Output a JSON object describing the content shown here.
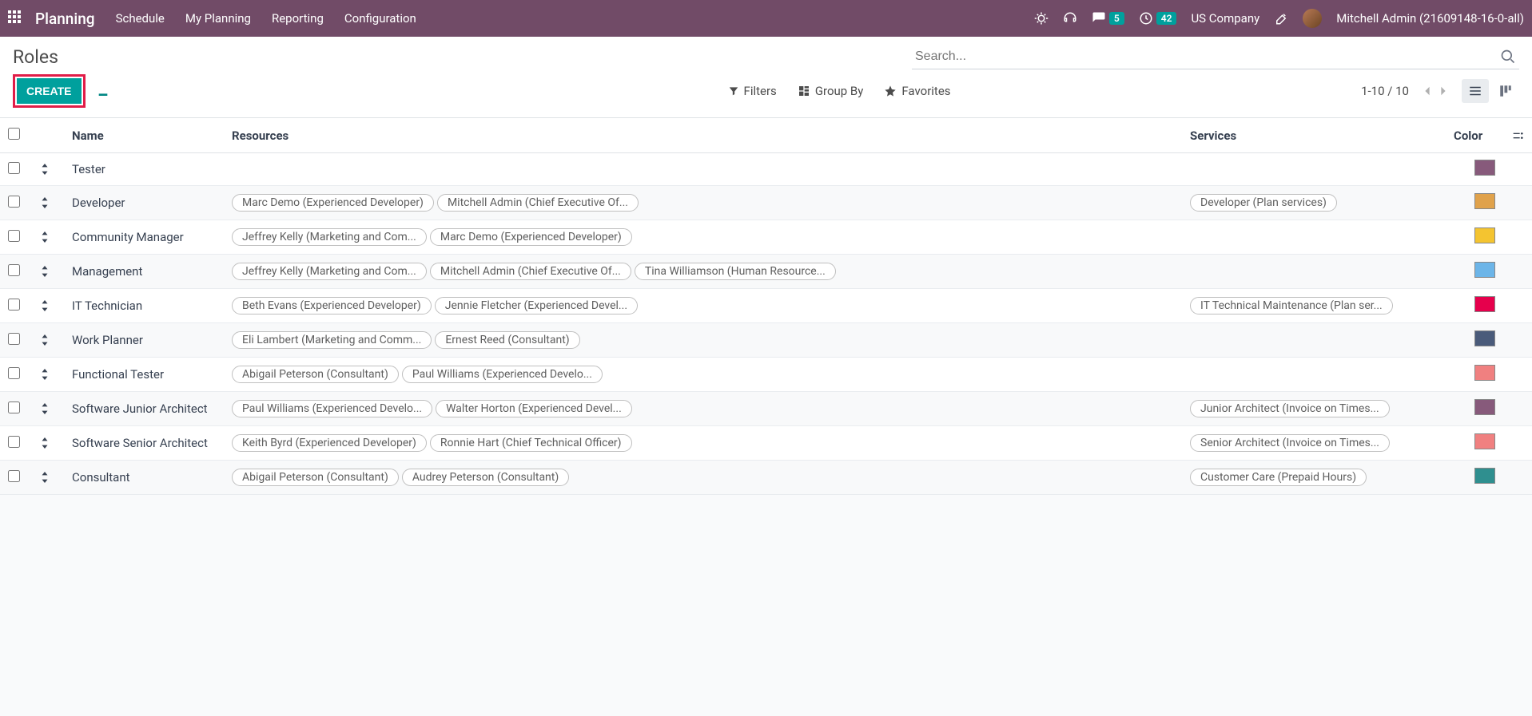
{
  "topbar": {
    "brand": "Planning",
    "menu": [
      "Schedule",
      "My Planning",
      "Reporting",
      "Configuration"
    ],
    "messages_badge": "5",
    "activities_badge": "42",
    "company": "US Company",
    "user": "Mitchell Admin (21609148-16-0-all)"
  },
  "control_panel": {
    "title": "Roles",
    "create_label": "Create",
    "search_placeholder": "Search...",
    "filters_label": "Filters",
    "groupby_label": "Group By",
    "favorites_label": "Favorites",
    "pager": "1-10 / 10"
  },
  "columns": {
    "name": "Name",
    "resources": "Resources",
    "services": "Services",
    "color": "Color"
  },
  "rows": [
    {
      "name": "Tester",
      "resources": [],
      "services": [],
      "color": "#875A7B"
    },
    {
      "name": "Developer",
      "resources": [
        "Marc Demo (Experienced Developer)",
        "Mitchell Admin (Chief Executive Of..."
      ],
      "services": [
        "Developer (Plan services)"
      ],
      "color": "#E0A24B"
    },
    {
      "name": "Community Manager",
      "resources": [
        "Jeffrey Kelly (Marketing and Com...",
        "Marc Demo (Experienced Developer)"
      ],
      "services": [],
      "color": "#F4C430"
    },
    {
      "name": "Management",
      "resources": [
        "Jeffrey Kelly (Marketing and Com...",
        "Mitchell Admin (Chief Executive Of...",
        "Tina Williamson (Human Resource..."
      ],
      "services": [],
      "color": "#6CB5E8"
    },
    {
      "name": "IT Technician",
      "resources": [
        "Beth Evans (Experienced Developer)",
        "Jennie Fletcher (Experienced Devel..."
      ],
      "services": [
        "IT Technical Maintenance (Plan ser..."
      ],
      "color": "#E6004C"
    },
    {
      "name": "Work Planner",
      "resources": [
        "Eli Lambert (Marketing and Comm...",
        "Ernest Reed (Consultant)"
      ],
      "services": [],
      "color": "#4A5B7A"
    },
    {
      "name": "Functional Tester",
      "resources": [
        "Abigail Peterson (Consultant)",
        "Paul Williams (Experienced Develo..."
      ],
      "services": [],
      "color": "#F08080"
    },
    {
      "name": "Software Junior Architect",
      "resources": [
        "Paul Williams (Experienced Develo...",
        "Walter Horton (Experienced Devel..."
      ],
      "services": [
        "Junior Architect (Invoice on Times..."
      ],
      "color": "#875A7B"
    },
    {
      "name": "Software Senior Architect",
      "resources": [
        "Keith Byrd (Experienced Developer)",
        "Ronnie Hart (Chief Technical Officer)"
      ],
      "services": [
        "Senior Architect (Invoice on Times..."
      ],
      "color": "#F08080"
    },
    {
      "name": "Consultant",
      "resources": [
        "Abigail Peterson (Consultant)",
        "Audrey Peterson (Consultant)"
      ],
      "services": [
        "Customer Care (Prepaid Hours)"
      ],
      "color": "#2F8F8F"
    }
  ]
}
